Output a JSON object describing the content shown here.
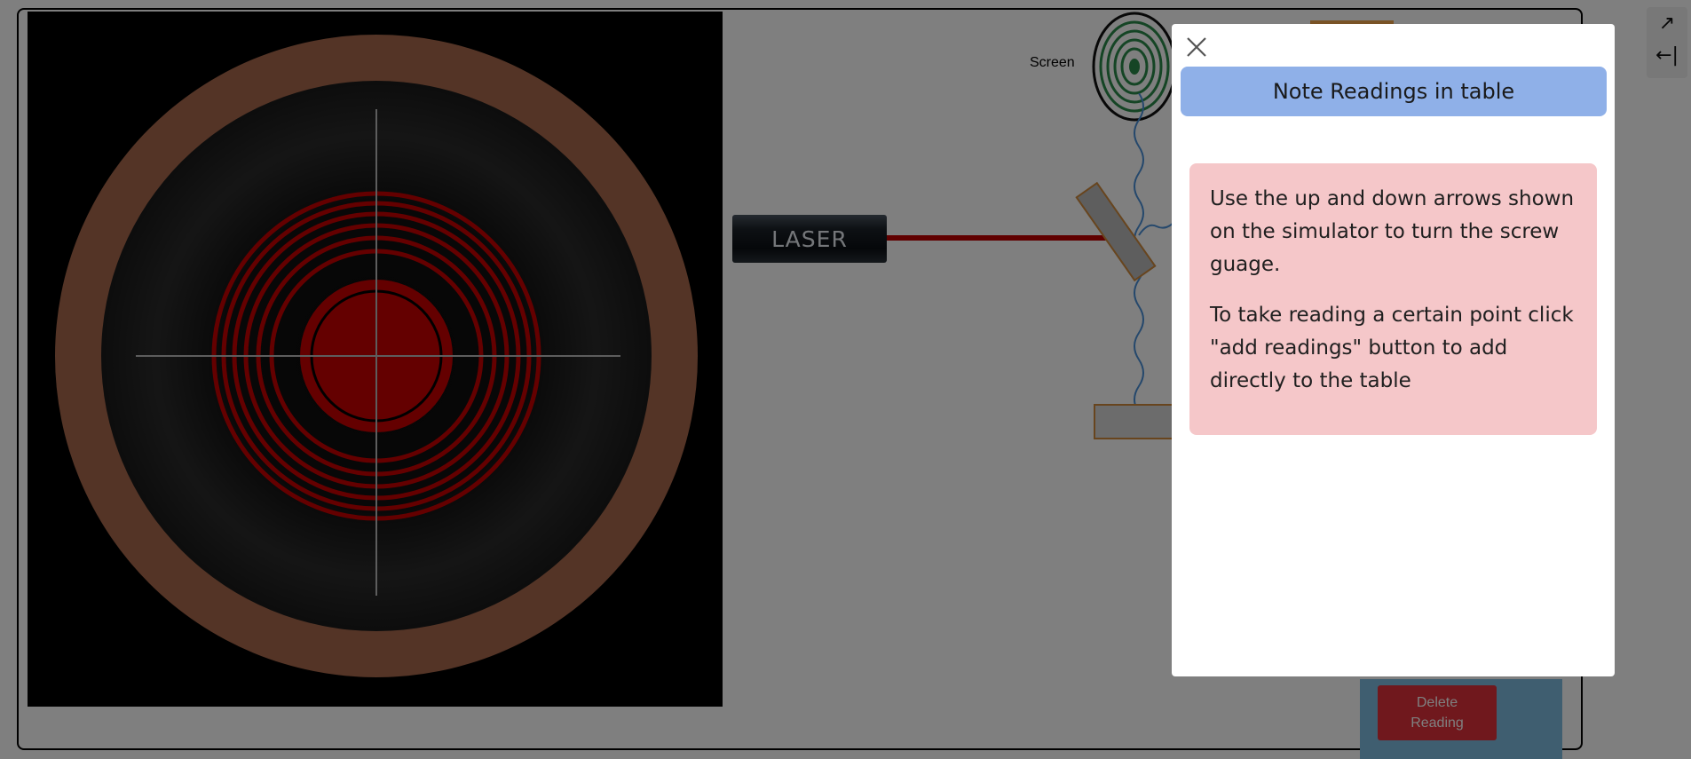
{
  "simulator": {
    "laser_label": "LASER",
    "screen_label": "Screen",
    "delete_button_label": "Delete Reading"
  },
  "toolbar": {
    "items": [
      {
        "icon": "expand-icon",
        "glyph": "↗"
      },
      {
        "icon": "collapse-icon",
        "glyph": "←|"
      }
    ]
  },
  "modal": {
    "title": "Note Readings in table",
    "paragraph_1": "Use the up and down arrows shown on the simulator to turn the screw guage.",
    "paragraph_2": "To take reading a certain point click \"add readings\" button to add directly to the table"
  },
  "colors": {
    "overlay": "rgba(0,0,0,0.5)",
    "title_bar": "#8fb0e8",
    "note_box": "#f5c7c9",
    "beam": "#c00000",
    "fringe": "#c80000",
    "delete_button": "#e0303a"
  }
}
